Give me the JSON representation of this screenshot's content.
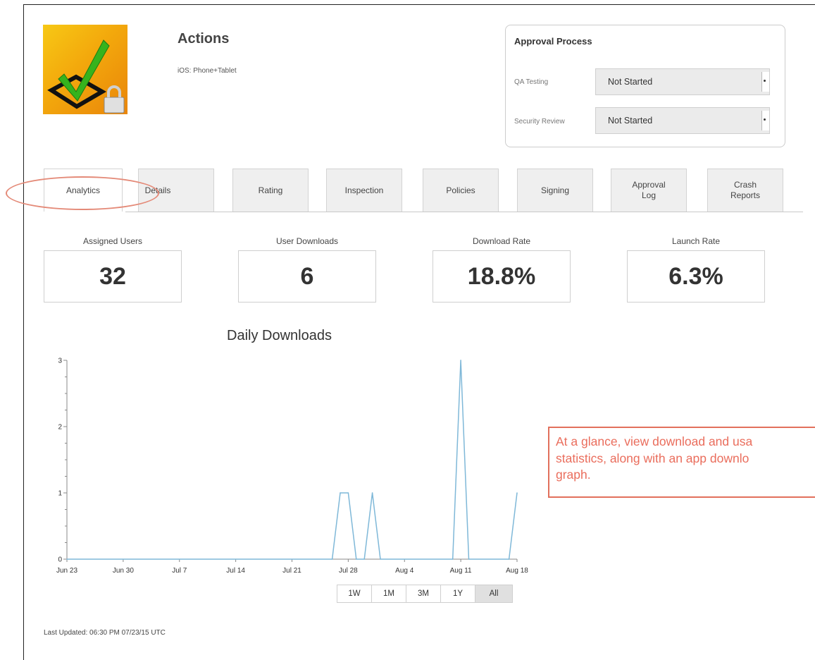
{
  "app": {
    "title": "Actions",
    "platform": "iOS: Phone+Tablet",
    "icon": "checkmark-lock-icon"
  },
  "approval": {
    "title": "Approval Process",
    "qa_label": "QA Testing",
    "qa_value": "Not Started",
    "security_label": "Security Review",
    "security_value": "Not Started"
  },
  "tabs": [
    {
      "label": "Analytics",
      "active": true
    },
    {
      "label": "Details"
    },
    {
      "label": "Rating"
    },
    {
      "label": "Inspection"
    },
    {
      "label": "Policies"
    },
    {
      "label": "Signing"
    },
    {
      "label": "Approval\nLog"
    },
    {
      "label": "Crash\nReports"
    }
  ],
  "stats": [
    {
      "label": "Assigned Users",
      "value": "32"
    },
    {
      "label": "User Downloads",
      "value": "6"
    },
    {
      "label": "Download Rate",
      "value": "18.8%"
    },
    {
      "label": "Launch Rate",
      "value": "6.3%"
    }
  ],
  "range_buttons": [
    "1W",
    "1M",
    "3M",
    "1Y",
    "All"
  ],
  "range_selected": "All",
  "last_updated": "Last Updated: 06:30 PM 07/23/15 UTC",
  "callout": {
    "line1": "At a glance, view download and usa",
    "line2": "statistics, along with an app downlo",
    "line3": "graph."
  },
  "colors": {
    "line": "#7fb8d8",
    "annotation": "#e2705c",
    "check": "#3cb521"
  },
  "chart_data": {
    "type": "line",
    "title": "Daily Downloads",
    "ylim": [
      0,
      3
    ],
    "yticks": [
      "0",
      "1",
      "2",
      "3"
    ],
    "xticks": [
      "Jun 23",
      "Jun 30",
      "Jul 7",
      "Jul 14",
      "Jul 21",
      "Jul 28",
      "Aug 4",
      "Aug 11",
      "Aug 18"
    ],
    "start_date": "2015-06-23",
    "end_date": "2015-08-18",
    "series": [
      {
        "points": [
          [
            "2015-06-23",
            0
          ],
          [
            "2015-07-26",
            0
          ],
          [
            "2015-07-27",
            1
          ],
          [
            "2015-07-28",
            1
          ],
          [
            "2015-07-29",
            0
          ],
          [
            "2015-07-30",
            0
          ],
          [
            "2015-07-31",
            1
          ],
          [
            "2015-08-01",
            0
          ],
          [
            "2015-08-10",
            0
          ],
          [
            "2015-08-11",
            3
          ],
          [
            "2015-08-12",
            0
          ],
          [
            "2015-08-17",
            0
          ],
          [
            "2015-08-18",
            1
          ]
        ]
      }
    ]
  }
}
